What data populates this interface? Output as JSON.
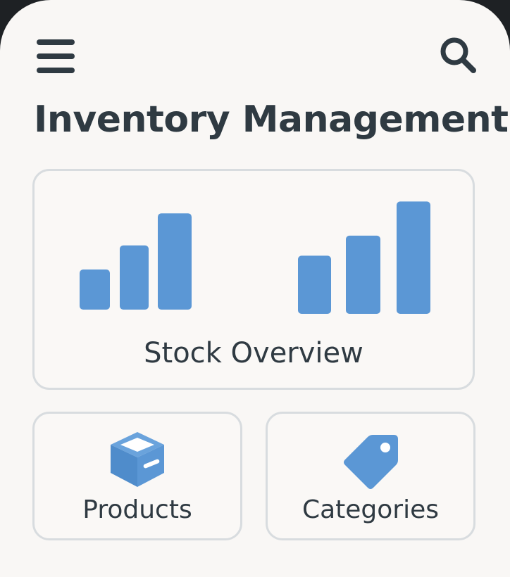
{
  "header": {
    "menu_icon": "hamburger-menu-icon",
    "search_icon": "search-icon"
  },
  "page": {
    "title": "Inventory Management"
  },
  "overview": {
    "label": "Stock Overview",
    "icon": "bar-chart-icon",
    "bar_color": "#5b97d5",
    "chart_data": {
      "type": "bar",
      "series": [
        {
          "values": [
            1,
            1.6,
            2.4
          ]
        },
        {
          "values": [
            1.45,
            1.95,
            2.8
          ]
        }
      ]
    }
  },
  "tiles": [
    {
      "label": "Products",
      "icon": "box-icon"
    },
    {
      "label": "Categories",
      "icon": "tag-icon"
    }
  ],
  "colors": {
    "accent": "#5b97d5",
    "text": "#2f3a42",
    "background": "#f9f7f5",
    "card_border": "#d8dcdf"
  }
}
